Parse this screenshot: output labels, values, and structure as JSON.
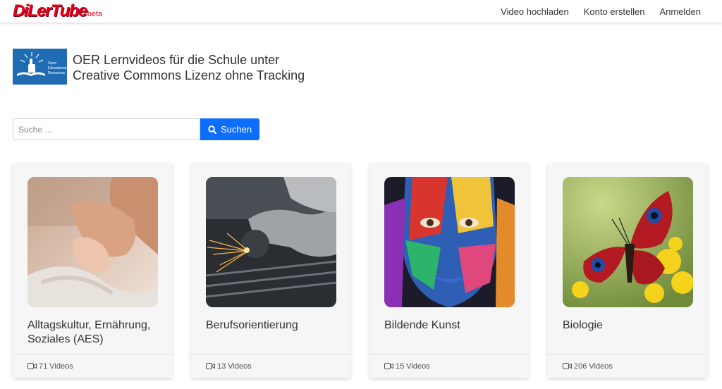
{
  "nav": {
    "logo": "DiLerTube",
    "logo_suffix": "beta",
    "links": [
      "Video hochladen",
      "Konto erstellen",
      "Anmelden"
    ]
  },
  "header": {
    "oer_logo_text": [
      "Open",
      "Educational",
      "Resources"
    ],
    "tagline_line1": "OER Lernvideos für die Schule unter",
    "tagline_line2": "Creative Commons Lizenz ohne Tracking"
  },
  "search": {
    "placeholder": "Suche ...",
    "button_label": "Suchen"
  },
  "categories": [
    {
      "title": "Alltagskultur, Ernährung, Soziales (AES)",
      "count": "71 Videos",
      "image": "baby-hand"
    },
    {
      "title": "Berufsorientierung",
      "count": "13 Videos",
      "image": "angle-grinder-sparks"
    },
    {
      "title": "Bildende Kunst",
      "count": "15 Videos",
      "image": "painted-face"
    },
    {
      "title": "Biologie",
      "count": "206 Videos",
      "image": "butterfly"
    }
  ],
  "colors": {
    "brand_red": "#e3001b",
    "button_blue": "#0d6efd",
    "oer_blue": "#1f6cb5"
  }
}
